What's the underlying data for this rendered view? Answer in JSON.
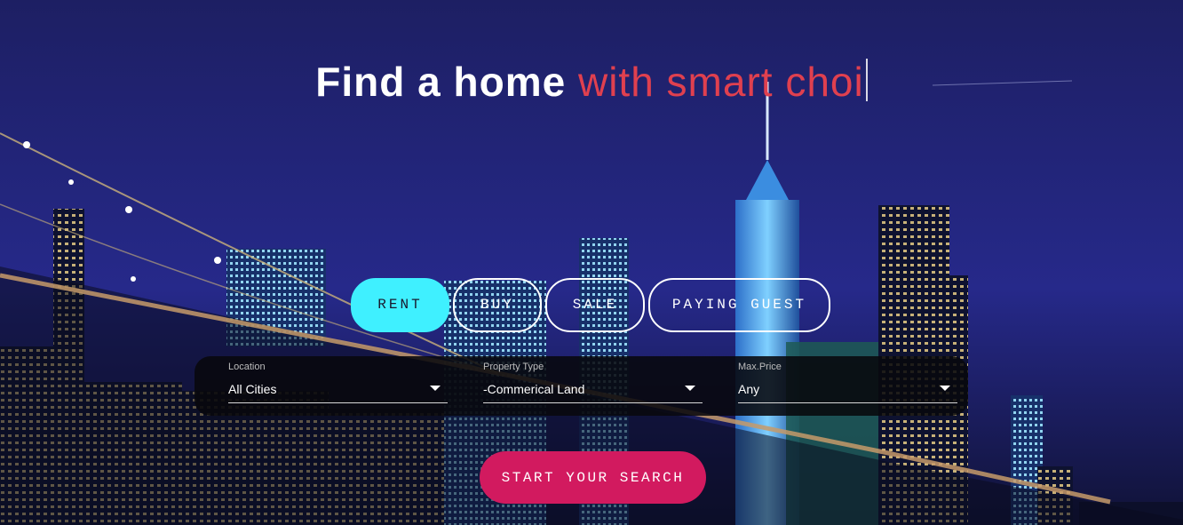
{
  "hero": {
    "headline_strong": "Find a home",
    "headline_accent": "with smart choi"
  },
  "tabs": [
    {
      "label": "RENT",
      "active": true
    },
    {
      "label": "BUY",
      "active": false
    },
    {
      "label": "SALE",
      "active": false
    },
    {
      "label": "PAYING GUEST",
      "active": false
    }
  ],
  "search": {
    "fields": [
      {
        "label": "Location",
        "value": "All Cities"
      },
      {
        "label": "Property Type",
        "value": "-Commerical Land"
      },
      {
        "label": "Max.Price",
        "value": "Any"
      }
    ],
    "submit_label": "START YOUR SEARCH"
  },
  "colors": {
    "accent": "#e0404f",
    "active_tab": "#3ff0ff",
    "cta": "#d21a5f",
    "night_sky": "#1b1d5e"
  }
}
